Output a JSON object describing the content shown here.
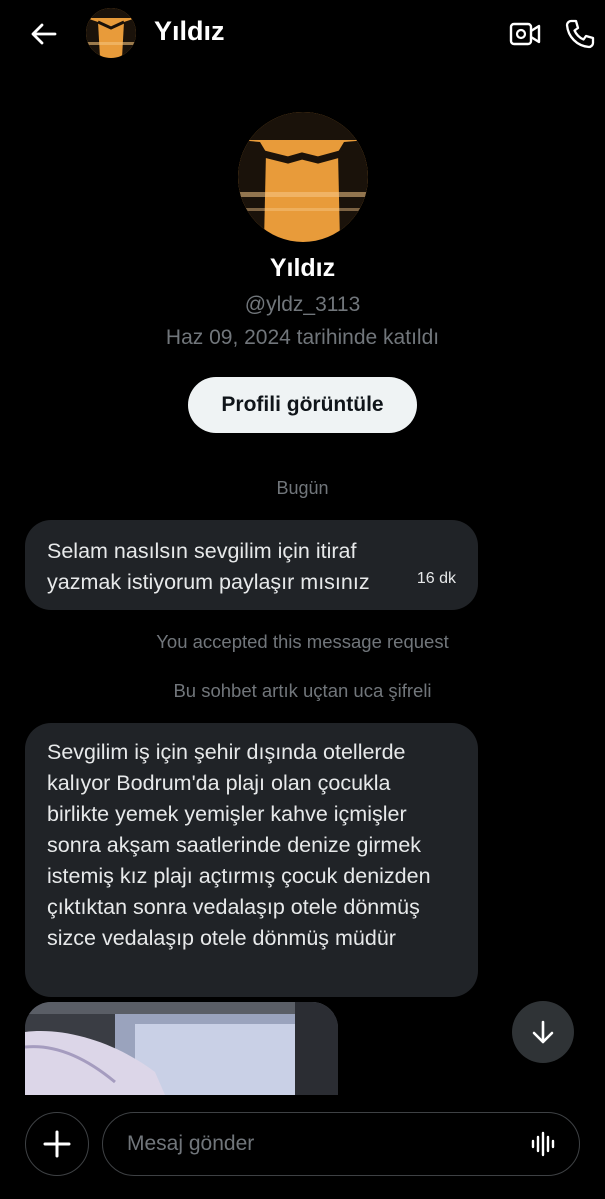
{
  "header": {
    "title": "Yıldız",
    "icons": {
      "back": "arrow-left-icon",
      "video": "video-call-icon",
      "call": "phone-icon"
    }
  },
  "profile": {
    "name": "Yıldız",
    "handle": "@yldz_3113",
    "joined": "Haz 09, 2024 tarihinde katıldı",
    "view_button": "Profili görüntüle"
  },
  "conversation": {
    "date_separator": "Bugün",
    "messages": [
      {
        "text": "Selam nasılsın sevgilim için itiraf yazmak istiyorum paylaşır mısınız",
        "time": "16 dk"
      },
      {
        "text": "Sevgilim iş için şehir dışında otellerde kalıyor Bodrum'da plajı olan çocukla birlikte yemek yemişler kahve içmişler sonra akşam saatlerinde denize girmek istemiş kız plajı açtırmış çocuk denizden çıktıktan sonra vedalaşıp otele dönmüş sizce vedalaşıp otele dönmüş müdür"
      }
    ],
    "system_notes": [
      "You accepted this message request",
      "Bu sohbet artık uçtan uca şifreli"
    ]
  },
  "composer": {
    "placeholder": "Mesaj gönder",
    "icons": {
      "add": "plus-icon",
      "voice": "voice-waveform-icon"
    }
  },
  "colors": {
    "background": "#000000",
    "bubble": "#202327",
    "muted_text": "#71767b",
    "button_bg": "#eff3f4"
  }
}
